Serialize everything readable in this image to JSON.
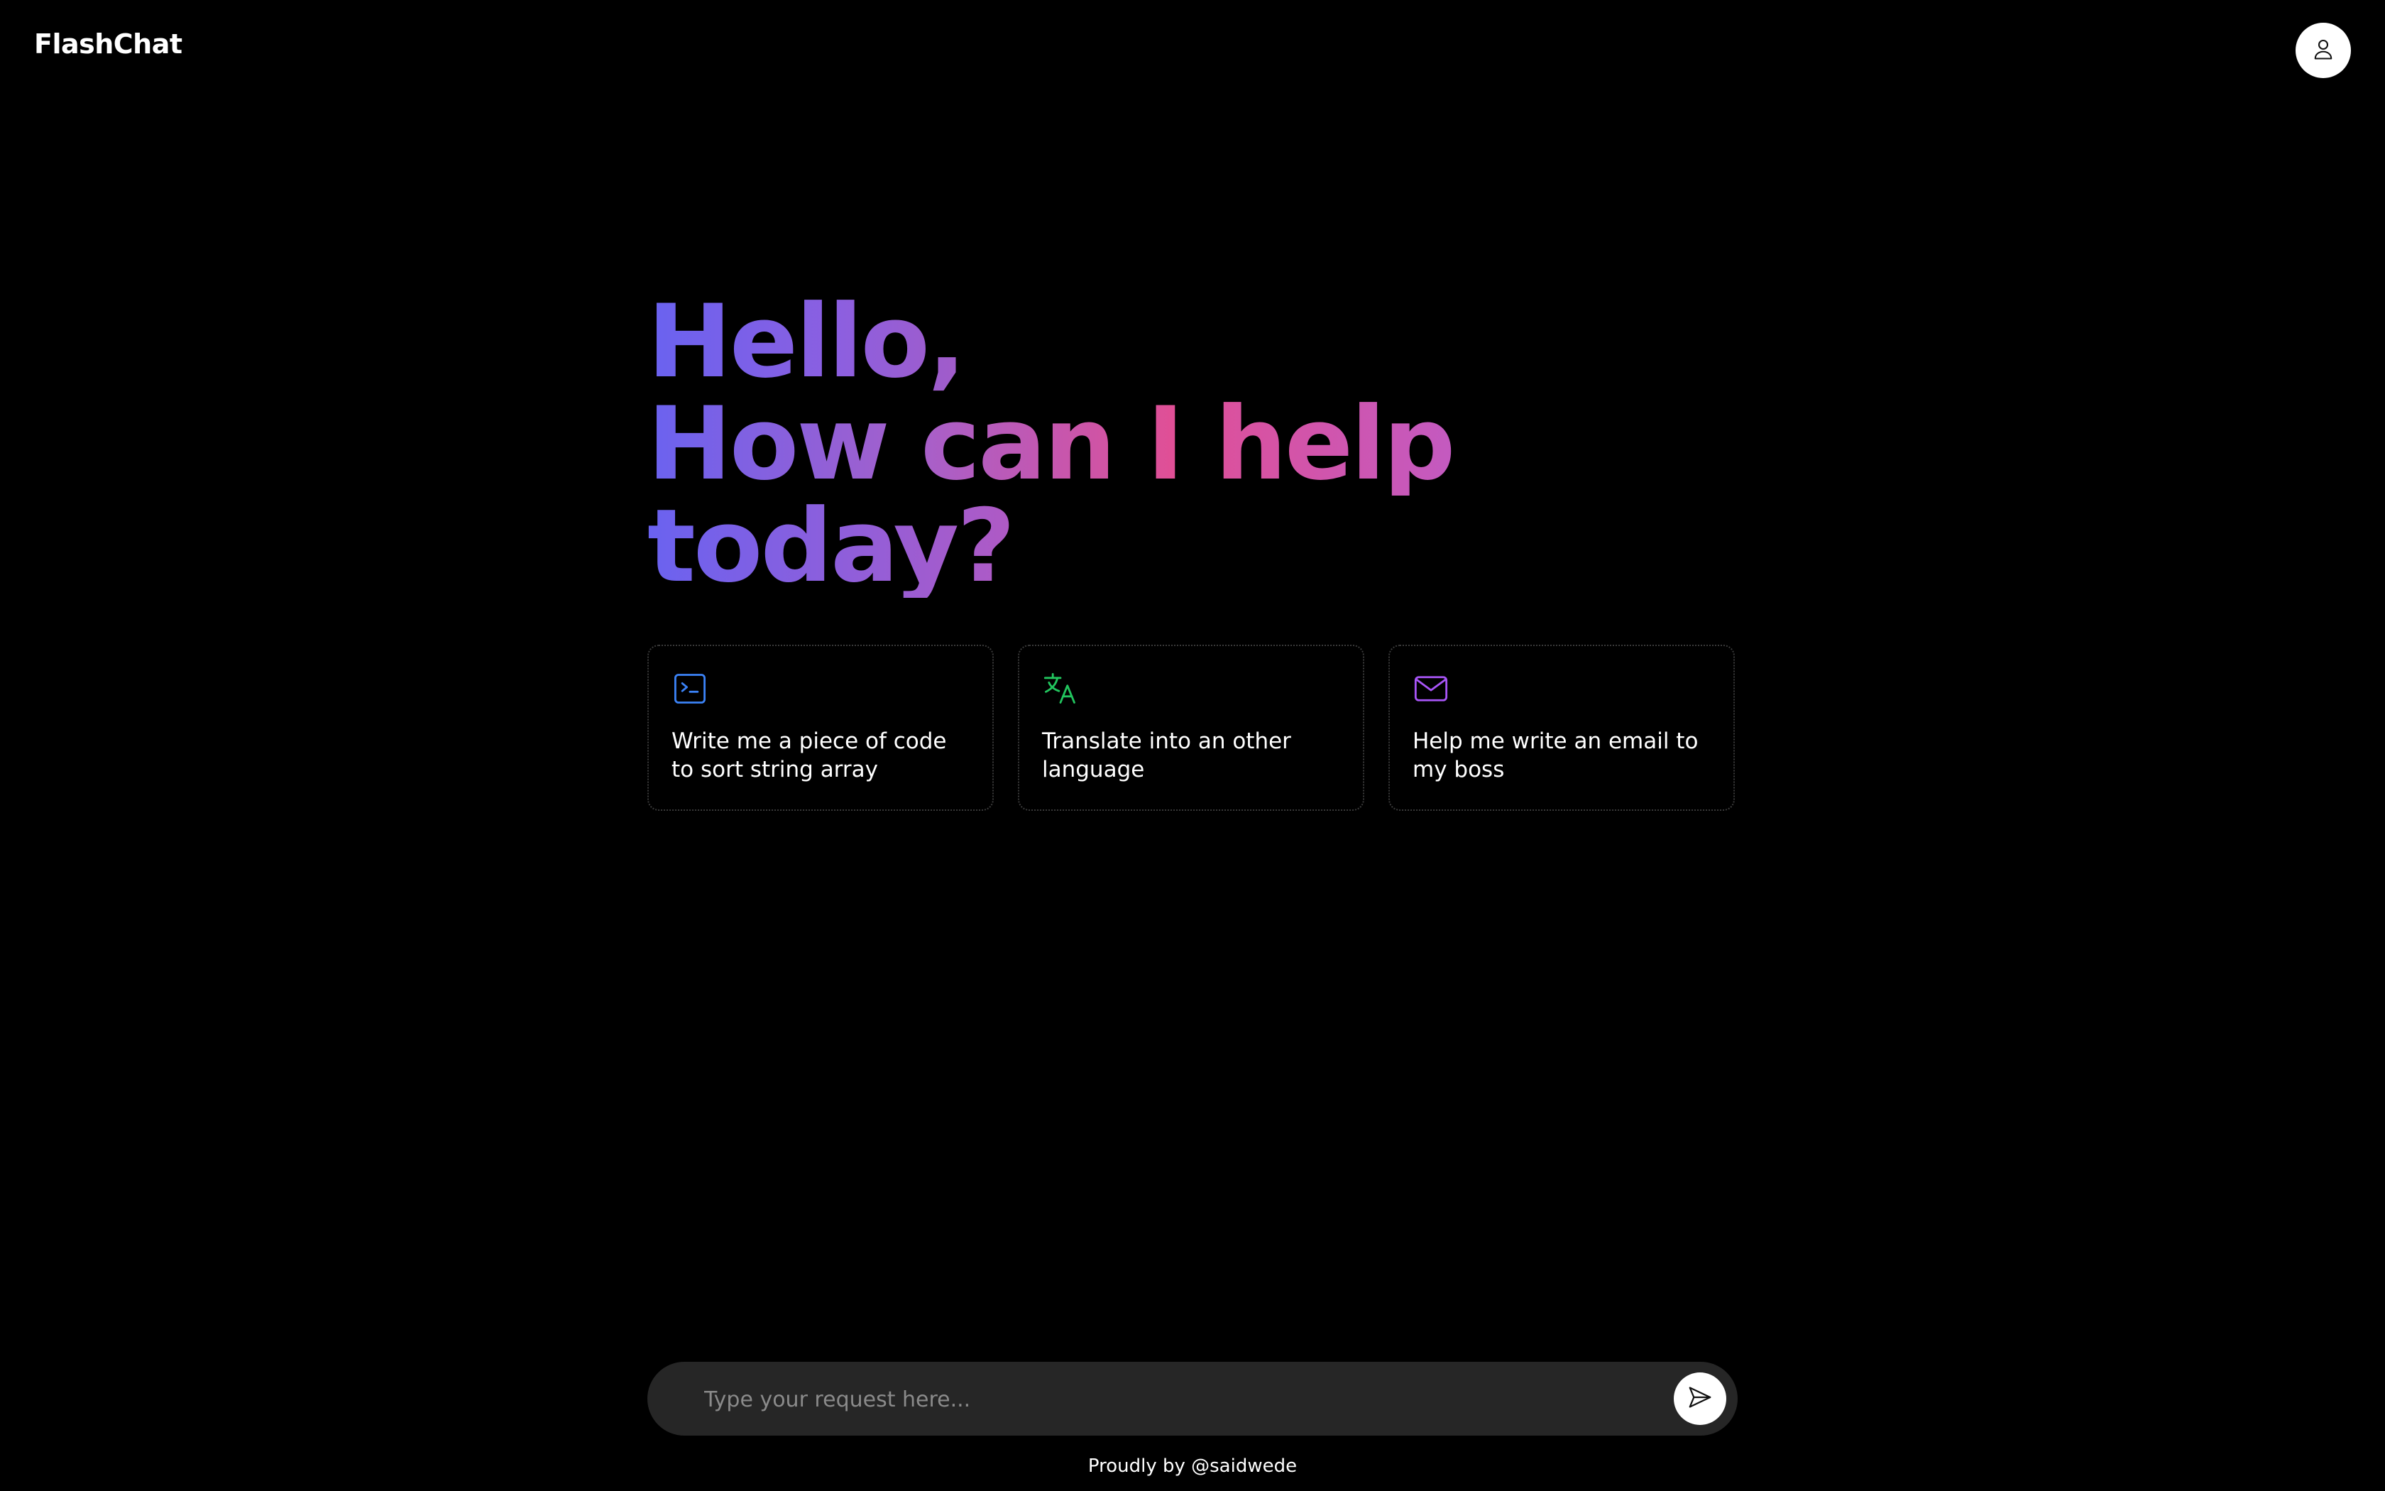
{
  "app": {
    "brand": "FlashChat",
    "avatar_icon": "user-icon"
  },
  "hero": {
    "line1": "Hello,",
    "line2": "How can I help",
    "line3": "today?",
    "gradient_colors": [
      "#6962f0",
      "#a95fc8",
      "#e04f96",
      "#c35ac0"
    ]
  },
  "suggestions": [
    {
      "icon": "terminal-icon",
      "icon_color": "#3b82f6",
      "text": "Write me a piece of code to sort string array"
    },
    {
      "icon": "translate-icon",
      "icon_color": "#22c55e",
      "text": "Translate into an other language"
    },
    {
      "icon": "mail-icon",
      "icon_color": "#a855f7",
      "text": "Help me write an email to my boss"
    }
  ],
  "composer": {
    "placeholder": "Type your request here...",
    "value": "",
    "send_icon": "send-icon"
  },
  "footer": {
    "text": "Proudly by @saidwede"
  }
}
